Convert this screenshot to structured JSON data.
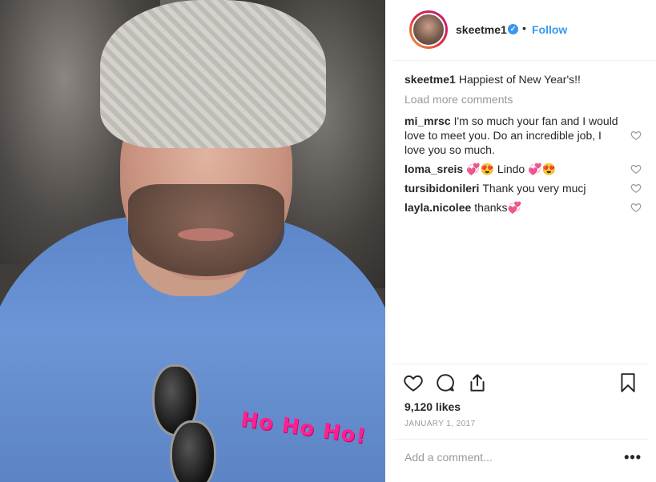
{
  "post": {
    "username": "skeetme1",
    "verified_icon": "verified-badge-icon",
    "separator": "•",
    "follow_label": "Follow",
    "photo_sticker": "Ho Ho Ho!"
  },
  "caption": {
    "user": "skeetme1",
    "text": "Happiest of New Year's!!"
  },
  "load_more_label": "Load more comments",
  "comments": [
    {
      "user": "mi_mrsc",
      "text": "I'm so much your fan and I would love to meet you. Do an incredible job, I love you so much."
    },
    {
      "user": "loma_sreis",
      "text": "💞😍 Lindo 💞😍"
    },
    {
      "user": "tursibidonileri",
      "text": "Thank you very mucj"
    },
    {
      "user": "layla.nicolee",
      "text": "thanks💞"
    }
  ],
  "actions": {
    "like_icon": "heart-icon",
    "comment_icon": "comment-icon",
    "share_icon": "share-icon",
    "save_icon": "bookmark-icon"
  },
  "likes_text": "9,120 likes",
  "date_text": "JANUARY 1, 2017",
  "add_comment": {
    "placeholder": "Add a comment...",
    "more_label": "•••"
  },
  "colors": {
    "link_blue": "#3897f0",
    "sticker_pink": "#ff1f8e",
    "muted_gray": "#999999"
  }
}
